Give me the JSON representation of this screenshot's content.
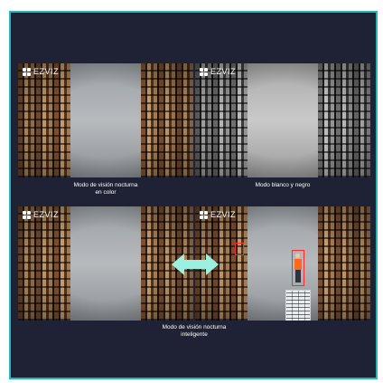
{
  "brand": {
    "name": "EZVIZ",
    "logo_icon": "ezviz-logo-icon"
  },
  "panels": [
    {
      "mode": "color",
      "brand": "EZVIZ"
    },
    {
      "mode": "black-and-white",
      "brand": "EZVIZ"
    },
    {
      "mode": "color",
      "brand": "EZVIZ"
    },
    {
      "mode": "smart-detection",
      "brand": "EZVIZ"
    }
  ],
  "captions": {
    "color_night_vision": "Modo de visión nocturna\nen color",
    "black_and_white": "Modo blanco y negro",
    "smart_night_vision": "Modo de visión nocturna\ninteligente"
  },
  "arrow_icon": "double-arrow-icon",
  "colors": {
    "frame_border": "#24b9b8",
    "background": "#1f2234",
    "arrow": "#9cf0df",
    "detection_box": "#ff2b2b"
  }
}
